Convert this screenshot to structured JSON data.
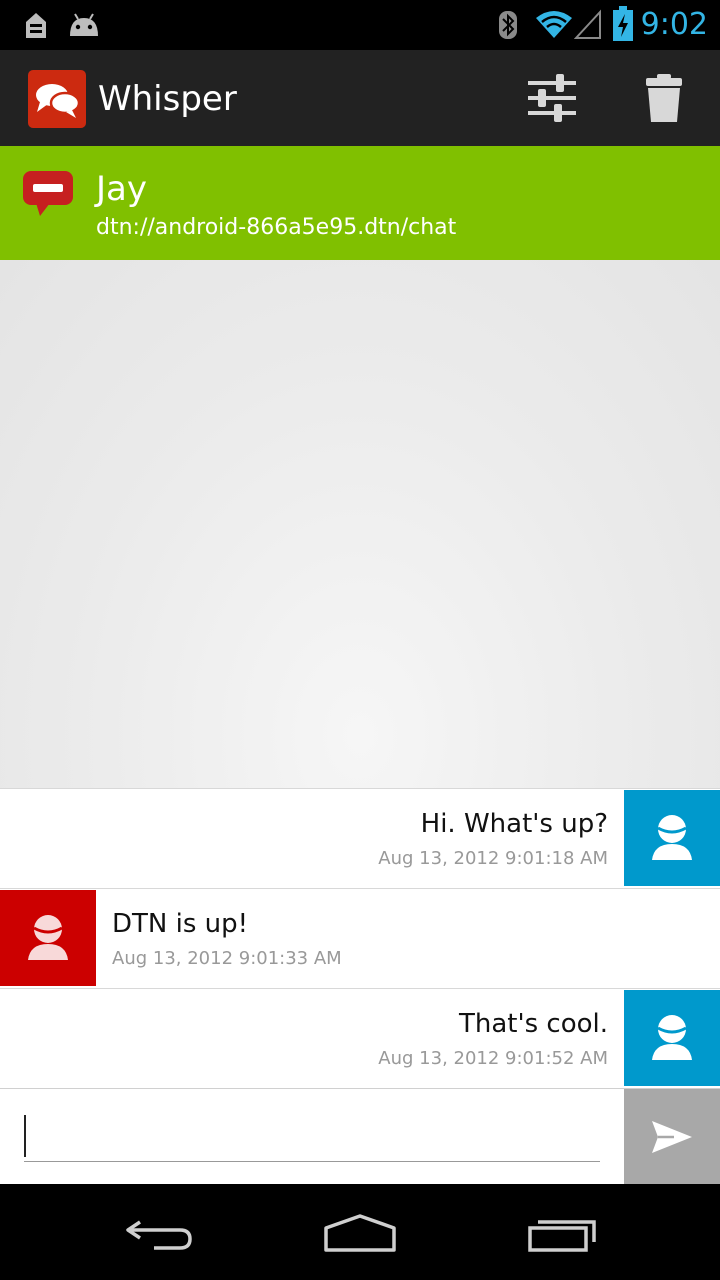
{
  "status_bar": {
    "time": "9:02",
    "icons": [
      "usb-debug-icon",
      "android-icon",
      "bluetooth-icon",
      "wifi-icon",
      "signal-icon",
      "battery-charging-icon"
    ],
    "time_color": "#33b5e5"
  },
  "action_bar": {
    "title": "Whisper",
    "icons": [
      "app-logo-icon",
      "settings-sliders-icon",
      "trash-icon"
    ],
    "background": "#222222"
  },
  "buddy": {
    "name": "Jay",
    "address": "dtn://android-866a5e95.dtn/chat",
    "status_icon": "busy-status-icon",
    "header_color": "#80c000"
  },
  "messages": [
    {
      "direction": "out",
      "text": "Hi. What's up?",
      "time": "Aug 13, 2012 9:01:18 AM"
    },
    {
      "direction": "in",
      "text": "DTN is up!",
      "time": "Aug 13, 2012 9:01:33 AM"
    },
    {
      "direction": "out",
      "text": "That's cool.",
      "time": "Aug 13, 2012 9:01:52 AM"
    }
  ],
  "composer": {
    "value": "",
    "placeholder": "",
    "send_icon": "send-icon"
  },
  "nav_bar": {
    "icons": [
      "back-icon",
      "home-icon",
      "recent-apps-icon"
    ]
  },
  "colors": {
    "outgoing_avatar": "#0099cc",
    "incoming_avatar": "#cc0000"
  }
}
